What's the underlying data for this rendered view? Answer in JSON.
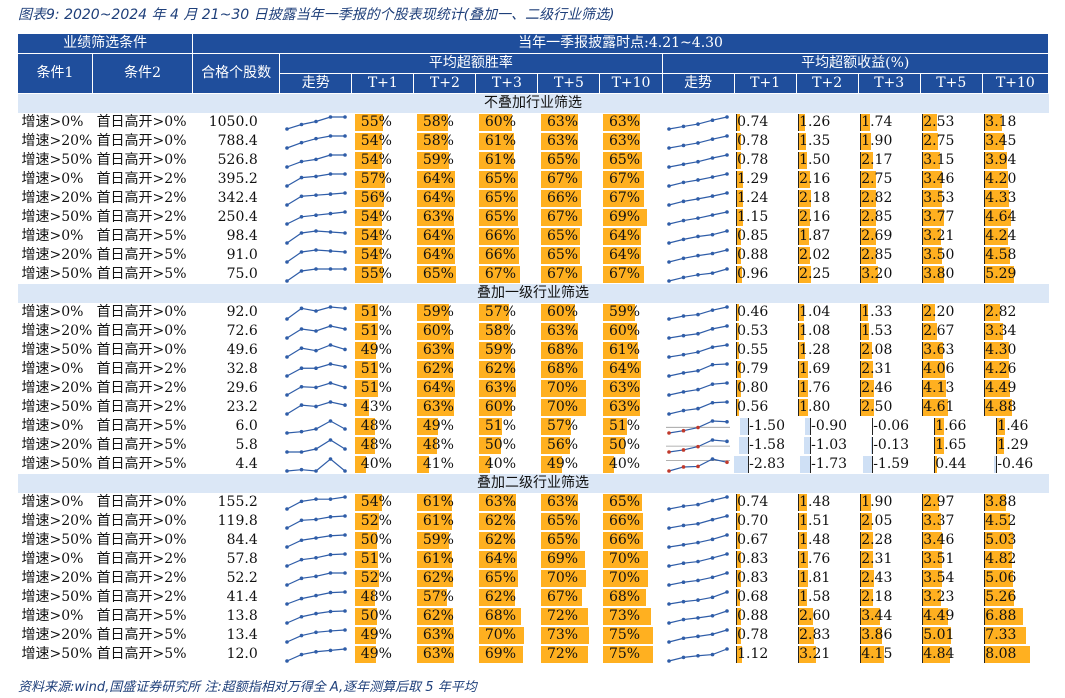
{
  "title": "图表9:  2020~2024 年 4 月 21~30 日披露当年一季报的个股表现统计(叠加一、二级行业筛选)",
  "footnote": "资料来源:wind,国盛证券研究所  注:超额指相对万得全 A,逐年测算后取 5 年平均",
  "header": {
    "group_filter": "业绩筛选条件",
    "group_time": "当年一季报披露时点:4.21~4.30",
    "cond1": "条件1",
    "cond2": "条件2",
    "count": "合格个股数",
    "winrate": "平均超额胜率",
    "excess": "平均超额收益(%)",
    "trend": "走势",
    "periods": [
      "T+1",
      "T+2",
      "T+3",
      "T+5",
      "T+10"
    ]
  },
  "colors": {
    "header_bg": "#1f4e9c",
    "section_bg": "#dbe7f6",
    "bar": "#ffb020",
    "neg_bar": "#cfe0f5",
    "spark_line": "#2f5da8",
    "spark_neg": "#c0392b"
  },
  "sections": [
    {
      "name": "不叠加行业筛选",
      "rows": [
        {
          "c1": "增速>0%",
          "c2": "首日高开>0%",
          "n": "1050.0",
          "win": [
            "55%",
            "58%",
            "60%",
            "63%",
            "63%"
          ],
          "ex": [
            "0.74",
            "1.26",
            "1.74",
            "2.53",
            "3.18"
          ]
        },
        {
          "c1": "增速>20%",
          "c2": "首日高开>0%",
          "n": "788.4",
          "win": [
            "54%",
            "58%",
            "61%",
            "63%",
            "63%"
          ],
          "ex": [
            "0.78",
            "1.35",
            "1.90",
            "2.75",
            "3.45"
          ]
        },
        {
          "c1": "增速>50%",
          "c2": "首日高开>0%",
          "n": "526.8",
          "win": [
            "54%",
            "59%",
            "61%",
            "65%",
            "65%"
          ],
          "ex": [
            "0.78",
            "1.50",
            "2.17",
            "3.15",
            "3.94"
          ]
        },
        {
          "c1": "增速>0%",
          "c2": "首日高开>2%",
          "n": "395.2",
          "win": [
            "57%",
            "64%",
            "65%",
            "67%",
            "67%"
          ],
          "ex": [
            "1.29",
            "2.16",
            "2.75",
            "3.46",
            "4.20"
          ]
        },
        {
          "c1": "增速>20%",
          "c2": "首日高开>2%",
          "n": "342.4",
          "win": [
            "56%",
            "64%",
            "65%",
            "66%",
            "67%"
          ],
          "ex": [
            "1.24",
            "2.18",
            "2.82",
            "3.53",
            "4.33"
          ]
        },
        {
          "c1": "增速>50%",
          "c2": "首日高开>2%",
          "n": "250.4",
          "win": [
            "54%",
            "63%",
            "65%",
            "67%",
            "69%"
          ],
          "ex": [
            "1.15",
            "2.16",
            "2.85",
            "3.77",
            "4.64"
          ]
        },
        {
          "c1": "增速>0%",
          "c2": "首日高开>5%",
          "n": "98.4",
          "win": [
            "54%",
            "64%",
            "66%",
            "65%",
            "64%"
          ],
          "ex": [
            "0.85",
            "1.87",
            "2.69",
            "3.21",
            "4.24"
          ]
        },
        {
          "c1": "增速>20%",
          "c2": "首日高开>5%",
          "n": "91.0",
          "win": [
            "54%",
            "64%",
            "66%",
            "65%",
            "64%"
          ],
          "ex": [
            "0.88",
            "2.02",
            "2.85",
            "3.50",
            "4.58"
          ]
        },
        {
          "c1": "增速>50%",
          "c2": "首日高开>5%",
          "n": "75.0",
          "win": [
            "55%",
            "65%",
            "67%",
            "67%",
            "67%"
          ],
          "ex": [
            "0.96",
            "2.25",
            "3.20",
            "3.80",
            "5.29"
          ]
        }
      ]
    },
    {
      "name": "叠加一级行业筛选",
      "rows": [
        {
          "c1": "增速>0%",
          "c2": "首日高开>0%",
          "n": "92.0",
          "win": [
            "51%",
            "59%",
            "57%",
            "60%",
            "59%"
          ],
          "ex": [
            "0.46",
            "1.04",
            "1.33",
            "2.20",
            "2.82"
          ]
        },
        {
          "c1": "增速>20%",
          "c2": "首日高开>0%",
          "n": "72.6",
          "win": [
            "51%",
            "60%",
            "58%",
            "63%",
            "60%"
          ],
          "ex": [
            "0.53",
            "1.08",
            "1.53",
            "2.67",
            "3.34"
          ]
        },
        {
          "c1": "增速>50%",
          "c2": "首日高开>0%",
          "n": "49.6",
          "win": [
            "49%",
            "63%",
            "59%",
            "68%",
            "61%"
          ],
          "ex": [
            "0.55",
            "1.28",
            "2.08",
            "3.63",
            "4.30"
          ]
        },
        {
          "c1": "增速>0%",
          "c2": "首日高开>2%",
          "n": "32.8",
          "win": [
            "51%",
            "62%",
            "62%",
            "68%",
            "64%"
          ],
          "ex": [
            "0.79",
            "1.69",
            "2.31",
            "4.06",
            "4.26"
          ]
        },
        {
          "c1": "增速>20%",
          "c2": "首日高开>2%",
          "n": "29.6",
          "win": [
            "51%",
            "64%",
            "63%",
            "70%",
            "63%"
          ],
          "ex": [
            "0.80",
            "1.76",
            "2.46",
            "4.13",
            "4.49"
          ]
        },
        {
          "c1": "增速>50%",
          "c2": "首日高开>2%",
          "n": "23.2",
          "win": [
            "43%",
            "63%",
            "60%",
            "70%",
            "63%"
          ],
          "ex": [
            "0.56",
            "1.80",
            "2.50",
            "4.61",
            "4.88"
          ]
        },
        {
          "c1": "增速>0%",
          "c2": "首日高开>5%",
          "n": "6.0",
          "win": [
            "48%",
            "49%",
            "51%",
            "57%",
            "51%"
          ],
          "ex": [
            "-1.50",
            "-0.90",
            "-0.06",
            "1.66",
            "1.46"
          ]
        },
        {
          "c1": "增速>20%",
          "c2": "首日高开>5%",
          "n": "5.8",
          "win": [
            "48%",
            "48%",
            "50%",
            "56%",
            "50%"
          ],
          "ex": [
            "-1.58",
            "-1.03",
            "-0.13",
            "1.65",
            "1.29"
          ]
        },
        {
          "c1": "增速>50%",
          "c2": "首日高开>5%",
          "n": "4.4",
          "win": [
            "40%",
            "41%",
            "40%",
            "49%",
            "40%"
          ],
          "ex": [
            "-2.83",
            "-1.73",
            "-1.59",
            "0.44",
            "-0.46"
          ]
        }
      ]
    },
    {
      "name": "叠加二级行业筛选",
      "rows": [
        {
          "c1": "增速>0%",
          "c2": "首日高开>0%",
          "n": "155.2",
          "win": [
            "54%",
            "61%",
            "63%",
            "63%",
            "65%"
          ],
          "ex": [
            "0.74",
            "1.48",
            "1.90",
            "2.97",
            "3.88"
          ]
        },
        {
          "c1": "增速>20%",
          "c2": "首日高开>0%",
          "n": "119.8",
          "win": [
            "52%",
            "61%",
            "62%",
            "65%",
            "66%"
          ],
          "ex": [
            "0.70",
            "1.51",
            "2.05",
            "3.37",
            "4.52"
          ]
        },
        {
          "c1": "增速>50%",
          "c2": "首日高开>0%",
          "n": "84.4",
          "win": [
            "50%",
            "59%",
            "62%",
            "65%",
            "66%"
          ],
          "ex": [
            "0.67",
            "1.48",
            "2.28",
            "3.46",
            "5.03"
          ]
        },
        {
          "c1": "增速>0%",
          "c2": "首日高开>2%",
          "n": "57.8",
          "win": [
            "51%",
            "61%",
            "64%",
            "69%",
            "70%"
          ],
          "ex": [
            "0.83",
            "1.76",
            "2.31",
            "3.51",
            "4.82"
          ]
        },
        {
          "c1": "增速>20%",
          "c2": "首日高开>2%",
          "n": "52.2",
          "win": [
            "52%",
            "62%",
            "65%",
            "70%",
            "70%"
          ],
          "ex": [
            "0.83",
            "1.81",
            "2.43",
            "3.54",
            "5.06"
          ]
        },
        {
          "c1": "增速>50%",
          "c2": "首日高开>2%",
          "n": "41.4",
          "win": [
            "48%",
            "57%",
            "62%",
            "67%",
            "68%"
          ],
          "ex": [
            "0.68",
            "1.58",
            "2.18",
            "3.23",
            "5.26"
          ]
        },
        {
          "c1": "增速>0%",
          "c2": "首日高开>5%",
          "n": "13.8",
          "win": [
            "50%",
            "62%",
            "68%",
            "72%",
            "73%"
          ],
          "ex": [
            "0.88",
            "2.60",
            "3.44",
            "4.49",
            "6.88"
          ]
        },
        {
          "c1": "增速>20%",
          "c2": "首日高开>5%",
          "n": "13.4",
          "win": [
            "49%",
            "63%",
            "70%",
            "73%",
            "75%"
          ],
          "ex": [
            "0.78",
            "2.83",
            "3.86",
            "5.01",
            "7.33"
          ]
        },
        {
          "c1": "增速>50%",
          "c2": "首日高开>5%",
          "n": "12.0",
          "win": [
            "49%",
            "63%",
            "69%",
            "72%",
            "75%"
          ],
          "ex": [
            "1.12",
            "3.21",
            "4.15",
            "4.84",
            "8.08"
          ]
        }
      ]
    }
  ]
}
